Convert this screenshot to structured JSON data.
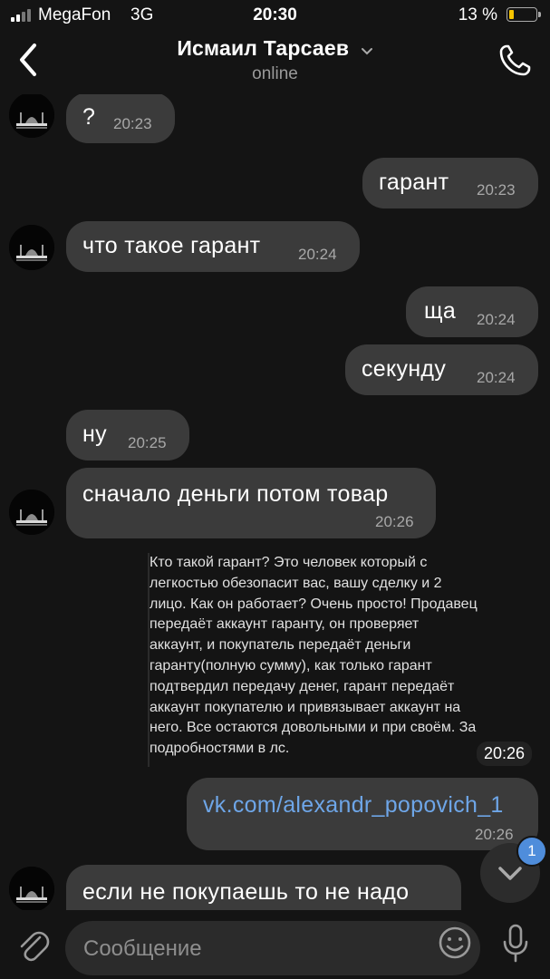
{
  "status_bar": {
    "carrier": "MegaFon",
    "network": "3G",
    "time": "20:30",
    "battery": "13 %",
    "battery_level": 0.13,
    "battery_color": "#f5c400"
  },
  "header": {
    "title": "Исмаил Тарсаев",
    "subtitle": "online",
    "back_icon": "chevron-left-icon",
    "call_icon": "phone-icon"
  },
  "messages": [
    {
      "side": "in",
      "text": "?",
      "time": "20:23"
    },
    {
      "side": "out",
      "text": "гарант",
      "time": "20:23"
    },
    {
      "side": "in",
      "text": "что такое гарант",
      "time": "20:24"
    },
    {
      "side": "out",
      "text": "ща",
      "time": "20:24"
    },
    {
      "side": "out",
      "text": "секунду",
      "time": "20:24"
    },
    {
      "side": "in",
      "text": "ну",
      "time": "20:25"
    },
    {
      "side": "in",
      "text": "сначало деньги потом товар",
      "time": "20:26"
    },
    {
      "side": "in",
      "type": "forwarded",
      "text": "Кто такой гарант? Это человек который с\nлегкостью обезопасит вас, вашу сделку и 2\nлицо. Как он работает? Очень просто! Продавец\nпередаёт аккаунт гаранту, он проверяет\nаккаунт, и покупатель передаёт деньги\nгаранту(полную сумму), как только гарант\nподтвердил передачу денег, гарант передаёт\nаккаунт покупателю и привязывает аккаунт на\nнего. Все остаются довольными и при своём. За\nподробностями в лс.",
      "time": "20:26"
    },
    {
      "side": "out",
      "type": "link",
      "text": "vk.com/alexandr_popovich_1",
      "time": "20:26"
    },
    {
      "side": "in",
      "text": "если не покупаешь то не надо",
      "time": ""
    }
  ],
  "composer": {
    "placeholder": "Сообщение",
    "attach_icon": "paperclip-icon",
    "emoji_icon": "smiley-icon",
    "mic_icon": "microphone-icon"
  },
  "scroll_button": {
    "icon": "chevron-down-icon",
    "badge": "1"
  },
  "colors": {
    "background": "#141414",
    "bubble": "#3b3b3b",
    "link": "#6ea6e8",
    "badge": "#4f8ddb"
  }
}
